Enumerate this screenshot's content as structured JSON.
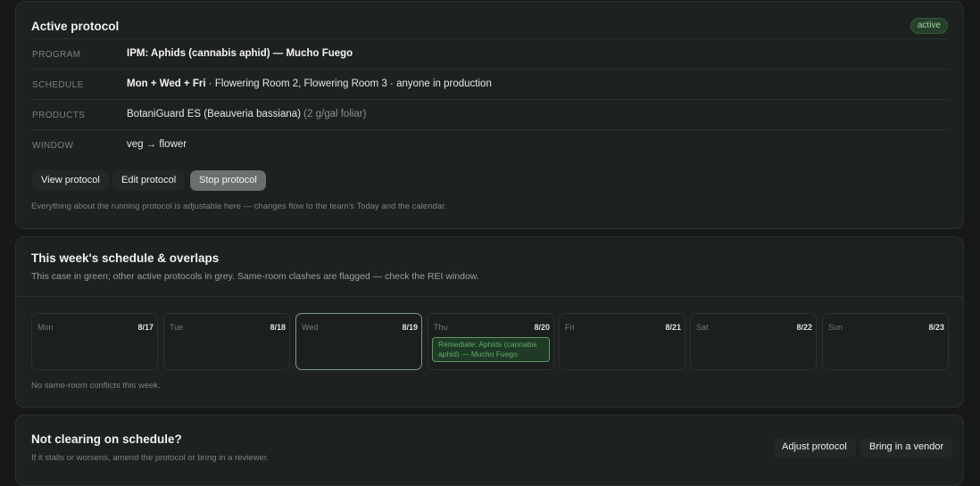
{
  "active_protocol": {
    "title": "Active protocol",
    "status_badge": "active",
    "rows": [
      {
        "key": "PROGRAM",
        "value_bold": "IPM: Aphids (cannabis aphid) — Mucho Fuego",
        "value_rest": "",
        "value_muted": ""
      },
      {
        "key": "SCHEDULE",
        "value_bold": "Mon + Wed + Fri",
        "value_rest": " · Flowering Room 2, Flowering Room 3 · anyone in production",
        "value_muted": ""
      },
      {
        "key": "PRODUCTS",
        "value_bold": "",
        "value_rest": "BotaniGuard ES (Beauveria bassiana)",
        "value_muted": " (2 g/gal foliar)"
      },
      {
        "key": "WINDOW",
        "value_bold": "",
        "value_rest": "veg → flower",
        "value_muted": ""
      }
    ],
    "buttons": {
      "view": "View protocol",
      "edit": "Edit protocol",
      "stop": "Stop protocol"
    },
    "hint": "Everything about the running protocol is adjustable here — changes flow to the team's Today and the calendar."
  },
  "week_schedule": {
    "title": "This week's schedule & overlaps",
    "subtitle": "This case in green; other active protocols in grey. Same-room clashes are flagged — check the REI window.",
    "days": [
      {
        "name": "Mon",
        "date": "8/17",
        "today": false,
        "events": []
      },
      {
        "name": "Tue",
        "date": "8/18",
        "today": false,
        "events": []
      },
      {
        "name": "Wed",
        "date": "8/19",
        "today": true,
        "events": []
      },
      {
        "name": "Thu",
        "date": "8/20",
        "today": false,
        "events": [
          "Remediate: Aphids (cannabis aphid) — Mucho Fuego"
        ]
      },
      {
        "name": "Fri",
        "date": "8/21",
        "today": false,
        "events": []
      },
      {
        "name": "Sat",
        "date": "8/22",
        "today": false,
        "events": []
      },
      {
        "name": "Sun",
        "date": "8/23",
        "today": false,
        "events": []
      }
    ],
    "footer": "No same-room conflicts this week."
  },
  "not_clearing": {
    "title": "Not clearing on schedule?",
    "subtitle": "If it stalls or worsens, amend the protocol or bring in a reviewer.",
    "buttons": {
      "adjust": "Adjust protocol",
      "vendor": "Bring in a vendor"
    }
  },
  "colors": {
    "background": "#161917",
    "card": "#1d211f",
    "accent_green": "#5fae69",
    "primary_button": "#6b6f6c"
  }
}
